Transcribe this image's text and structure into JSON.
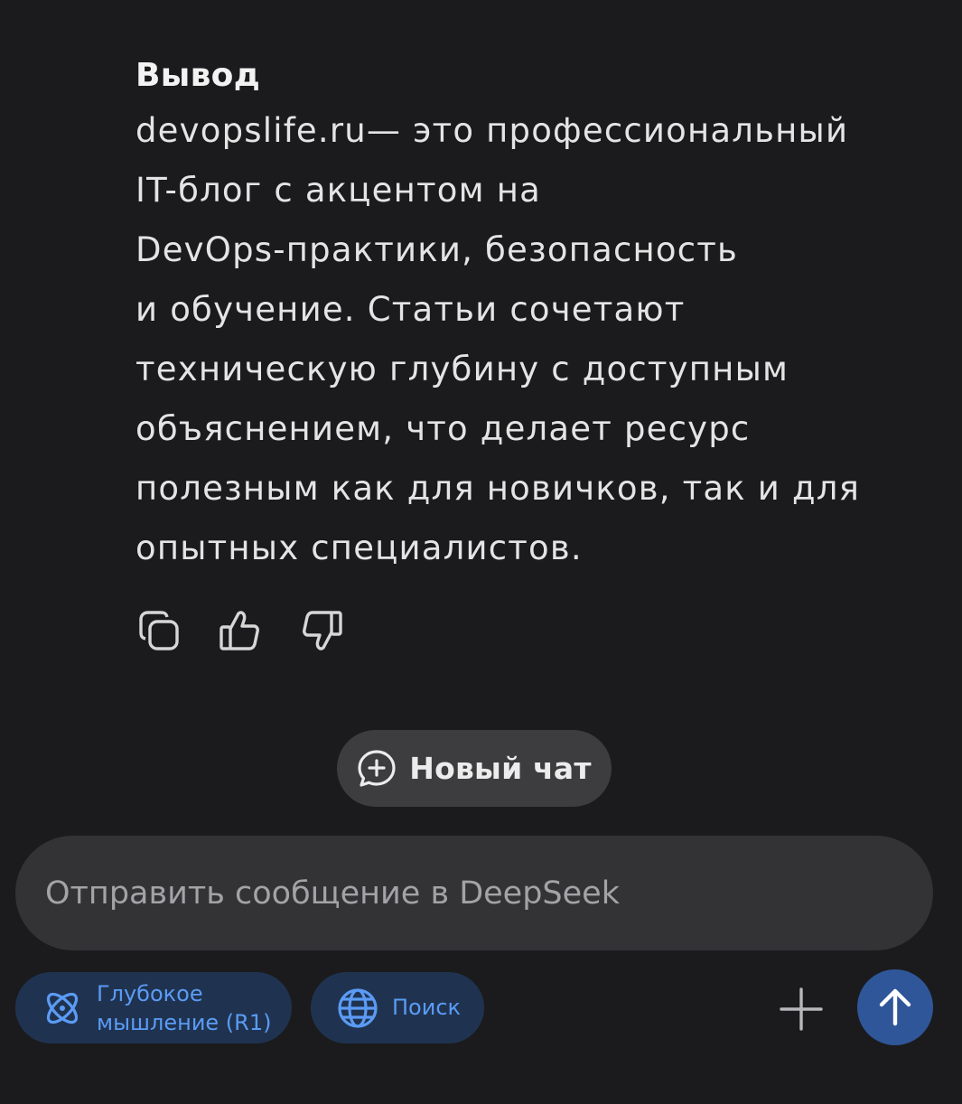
{
  "message": {
    "heading": "Вывод",
    "lines": [
      "devopslife.ru— это профессиональный",
      "IT-блог с акцентом на",
      "DevOps-практики, безопасность",
      "и обучение. Статьи сочетают",
      "техническую глубину с доступным",
      "объяснением, что делает ресурс",
      "полезным как для новичков, так и для",
      "опытных специалистов."
    ]
  },
  "actions": {
    "copy_icon": "copy-icon",
    "like_icon": "thumbs-up-icon",
    "dislike_icon": "thumbs-down-icon"
  },
  "new_chat": {
    "label": "Новый чат",
    "icon": "chat-plus-icon"
  },
  "composer": {
    "placeholder": "Отправить сообщение в DeepSeek",
    "value": ""
  },
  "chips": {
    "deep_thinking": {
      "label_line1": "Глубокое",
      "label_line2": "мышление (R1)",
      "icon": "atom-icon"
    },
    "search": {
      "label": "Поиск",
      "icon": "globe-icon"
    }
  },
  "colors": {
    "background": "#1b1b1d",
    "chip_bg": "#1f3350",
    "chip_text": "#5b9bf5",
    "send_button": "#2f5698"
  }
}
